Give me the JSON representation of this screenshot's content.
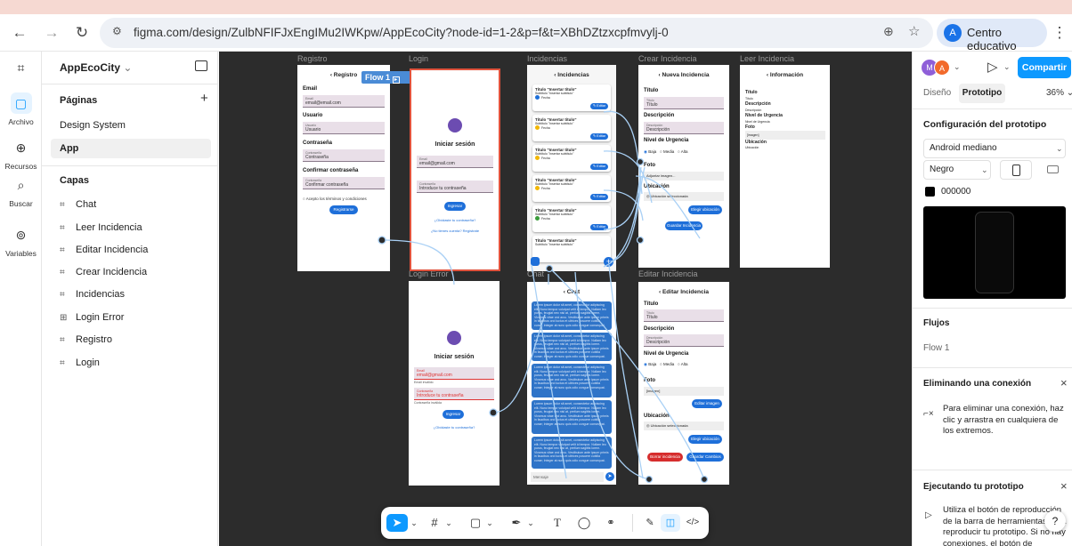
{
  "browser": {
    "back_icon": "arrow-left-icon",
    "forward_icon": "arrow-right-icon",
    "reload_icon": "reload-icon",
    "url": "figma.com/design/ZulbNFIFJxEngIMu2IWKpw/AppEcoCity?node-id=1-2&p=f&t=XBhDZtzxcpfmvylj-0",
    "profile_initial": "A",
    "profile_label": "Centro educativo"
  },
  "rail": {
    "items": [
      {
        "label": "Archivo",
        "icon": "file-icon"
      },
      {
        "label": "Recursos",
        "icon": "assets-icon"
      },
      {
        "label": "Buscar",
        "icon": "search-icon"
      },
      {
        "label": "Variables",
        "icon": "variables-icon"
      }
    ]
  },
  "sidebar": {
    "project_name": "AppEcoCity",
    "pages_title": "Páginas",
    "add_symbol": "+",
    "pages": [
      "Design System",
      "App"
    ],
    "layers_title": "Capas",
    "layers": [
      "Chat",
      "Leer Incidencia",
      "Editar Incidencia",
      "Crear Incidencia",
      "Incidencias",
      "Login Error",
      "Registro",
      "Login"
    ]
  },
  "canvas": {
    "flow_badge": "Flow 1",
    "frames": {
      "registro": {
        "label": "Registro",
        "header": "Registro",
        "email_label": "Email",
        "email_hint": "Email",
        "email_value": "email@email.com",
        "usuario_label": "Usuario",
        "usuario_hint": "Usuario",
        "usuario_value": "Usuario",
        "pass_label": "Contraseña",
        "pass_hint": "Contraseña",
        "pass_value": "Contraseña",
        "confirm_label": "Confirmar contraseña",
        "confirm_hint": "Contraseña",
        "confirm_value": "Confirmar contraseña",
        "terms": "Acepto los términos y condiciones",
        "button": "Registrarse"
      },
      "login": {
        "label": "Login",
        "title": "Iniciar sesión",
        "email_hint": "Email",
        "email_value": "email@gmail.com",
        "pass_hint": "Contraseña",
        "pass_value": "Introduce tu contraseña",
        "button": "Ingresar",
        "forgot": "¿Olvidaste tu contraseña?",
        "register": "¿No tienes cuenta? Regístrate"
      },
      "incidencias": {
        "label": "Incidencias",
        "header": "Incidencias",
        "cards": [
          {
            "title": "Título \"Insertar título\"",
            "subtitle": "Subtítulo \"Insertar subtítulo\"",
            "date": "Fecha",
            "edit": "Editar",
            "status_color": "#1e6fd9"
          },
          {
            "title": "Título \"Insertar título\"",
            "subtitle": "Subtítulo \"Insertar subtítulo\"",
            "date": "Fecha",
            "edit": "Editar",
            "status_color": "#f2b705"
          },
          {
            "title": "Título \"Insertar título\"",
            "subtitle": "Subtítulo \"Insertar subtítulo\"",
            "date": "Fecha",
            "edit": "Editar",
            "status_color": "#f2b705"
          },
          {
            "title": "Título \"Insertar título\"",
            "subtitle": "Subtítulo \"Insertar subtítulo\"",
            "date": "Fecha",
            "edit": "Editar",
            "status_color": "#f2b705"
          },
          {
            "title": "Título \"Insertar título\"",
            "subtitle": "Subtítulo \"Insertar subtítulo\"",
            "date": "Fecha",
            "edit": "Editar",
            "status_color": "#3a9b3a"
          },
          {
            "title": "Título \"Insertar título\"",
            "subtitle": "Subtítulo \"Insertar subtítulo\"",
            "date": "",
            "edit": "",
            "status_color": "#1e6fd9"
          }
        ]
      },
      "crear": {
        "label": "Crear Incidencia",
        "header": "Nueva Incidencia",
        "titulo_label": "Título",
        "titulo_hint": "Título",
        "titulo_value": "Título",
        "desc_label": "Descripción",
        "desc_hint": "Descripción",
        "desc_value": "Descripción",
        "urgencia_label": "Nivel de Urgencia",
        "urg_options": [
          "Baja",
          "Media",
          "Alta"
        ],
        "foto_label": "Foto",
        "foto_value": "Adjuntar imagen...",
        "ubic_label": "Ubicación",
        "ubic_value": "Ubicación seleccionada",
        "elegir_btn": "Elegir ubicación",
        "guardar_btn": "Guardar Incidencia"
      },
      "leer": {
        "label": "Leer Incidencia",
        "header": "Información",
        "rows": [
          "Título",
          "Título",
          "Descripción",
          "Descripción",
          "Nivel de Urgencia",
          "Nivel de Urgencia",
          "Foto",
          "[imagen]",
          "Ubicación",
          "Ubicación"
        ]
      },
      "loginerror": {
        "label": "Login Error",
        "title": "Iniciar sesión",
        "email_hint": "Email",
        "email_value": "email@gmail.com",
        "email_err": "Email inválido",
        "pass_hint": "Contraseña",
        "pass_value": "Introduce tu contraseña",
        "pass_err": "Contraseña inválida",
        "button": "Ingresar",
        "forgot": "¿Olvidaste tu contraseña?"
      },
      "chat": {
        "label": "Chat",
        "header": "Chat",
        "lorem": "Lorem ipsum dolor sit amet, consectetur adipiscing elit. Nunc tempor volutpat velit id tempor. Nullam leo purus, feugiat nec nisl at, pretium sagittis lorem. Vivamus vitae orci arcu. Vestibulum ante ipsum primis in faucibus orci luctus et ultrices posuere cubilia curae; Integer at nunc quis odio congue consequat.",
        "placeholder": "Mensaje"
      },
      "editar": {
        "label": "Editar Incidencia",
        "header": "Editar Incidencia",
        "titulo_label": "Título",
        "titulo_hint": "Título",
        "titulo_value": "Título",
        "desc_label": "Descripción",
        "desc_hint": "Descripción",
        "desc_value": "Descripción",
        "urgencia_label": "Nivel de Urgencia",
        "urg_options": [
          "Baja",
          "Media",
          "Alta"
        ],
        "foto_label": "Foto",
        "foto_value": "[imagen]",
        "editar_img_btn": "Editar imagen",
        "ubic_label": "Ubicación",
        "ubic_value": "Ubicación seleccionada",
        "elegir_btn": "Elegir ubicación",
        "borrar_btn": "Borrar incidencia",
        "guardar_btn": "Guardar Cambios"
      }
    }
  },
  "bottom_toolbar": {
    "tools": [
      "move-tool-icon",
      "frame-tool-icon",
      "rectangle-tool-icon",
      "pen-tool-icon",
      "text-tool-icon",
      "comment-tool-icon",
      "actions-tool-icon",
      "draw-mode-icon",
      "design-mode-icon",
      "dev-mode-icon"
    ],
    "text_tool": "T"
  },
  "right_panel": {
    "avatar1": "M",
    "avatar2": "A",
    "share_button": "Compartir",
    "tab_design": "Diseño",
    "tab_prototype": "Prototipo",
    "zoom": "36%",
    "config_title": "Configuración del prototipo",
    "device": "Android mediano",
    "color_model": "Negro",
    "bg_color": "000000",
    "flows_title": "Flujos",
    "flow_item": "Flow 1",
    "remove_title": "Eliminando una conexión",
    "remove_text": "Para eliminar una conexión, haz clic y arrastra en cualquiera de los extremos.",
    "run_title": "Ejecutando tu prototipo",
    "run_text": "Utiliza el botón de reproducción de la barra de herramientas para reproducir tu prototipo. Si no hay conexiones, el botón de reproducción se puede utilizar para reproducir una presentación",
    "help": "?",
    "accent_color": "#0d99ff"
  }
}
